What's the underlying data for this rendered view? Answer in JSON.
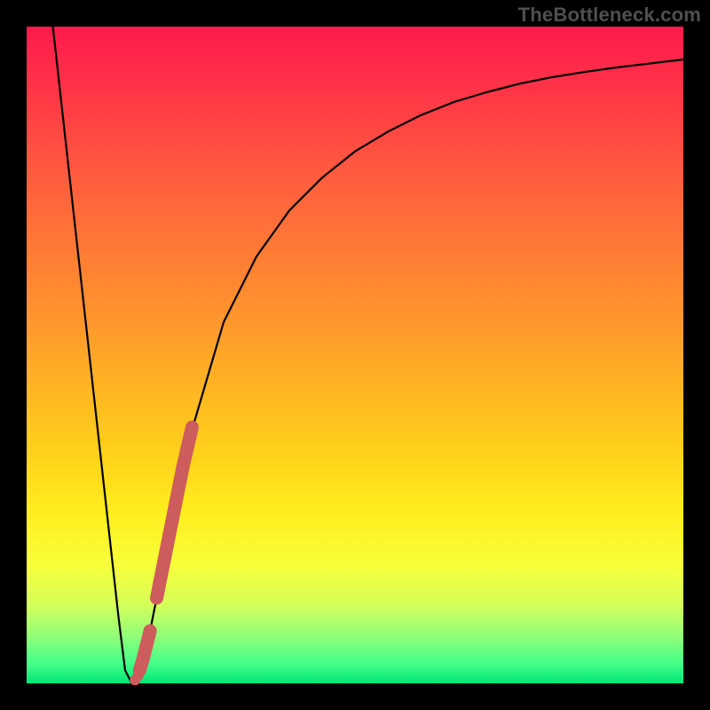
{
  "watermark": "TheBottleneck.com",
  "colors": {
    "frame": "#000000",
    "curve": "#000000",
    "dot_fill": "#cd5c5c",
    "dot_stroke": "#b84a4a",
    "gradient_top": "#ff1a4d",
    "gradient_bottom": "#00e676"
  },
  "chart_data": {
    "type": "line",
    "title": "",
    "xlabel": "",
    "ylabel": "",
    "xlim": [
      0,
      100
    ],
    "ylim": [
      0,
      100
    ],
    "grid": false,
    "legend": false,
    "series": [
      {
        "name": "bottleneck-curve",
        "x": [
          4,
          6,
          8,
          10,
          12,
          14,
          15,
          16,
          17,
          18,
          20,
          22,
          25,
          30,
          35,
          40,
          45,
          50,
          55,
          60,
          65,
          70,
          75,
          80,
          85,
          90,
          95,
          100
        ],
        "y": [
          100,
          82,
          64,
          46,
          28,
          10,
          2,
          0,
          1,
          4,
          14,
          24,
          38,
          55,
          65,
          72,
          77,
          81,
          84,
          86.5,
          88.5,
          90,
          91.3,
          92.3,
          93.1,
          93.8,
          94.4,
          95
        ]
      }
    ],
    "dots_cluster": {
      "name": "highlighted-points",
      "points": [
        {
          "x": 17.2,
          "y": 2
        },
        {
          "x": 17.8,
          "y": 4
        },
        {
          "x": 18.3,
          "y": 6
        },
        {
          "x": 18.8,
          "y": 8
        },
        {
          "x": 19.8,
          "y": 13
        },
        {
          "x": 20.6,
          "y": 17
        },
        {
          "x": 21.4,
          "y": 21
        },
        {
          "x": 22.2,
          "y": 25
        },
        {
          "x": 23.0,
          "y": 29
        },
        {
          "x": 23.8,
          "y": 33
        },
        {
          "x": 24.5,
          "y": 36
        },
        {
          "x": 25.2,
          "y": 39
        }
      ]
    },
    "minimum_x": 16
  }
}
